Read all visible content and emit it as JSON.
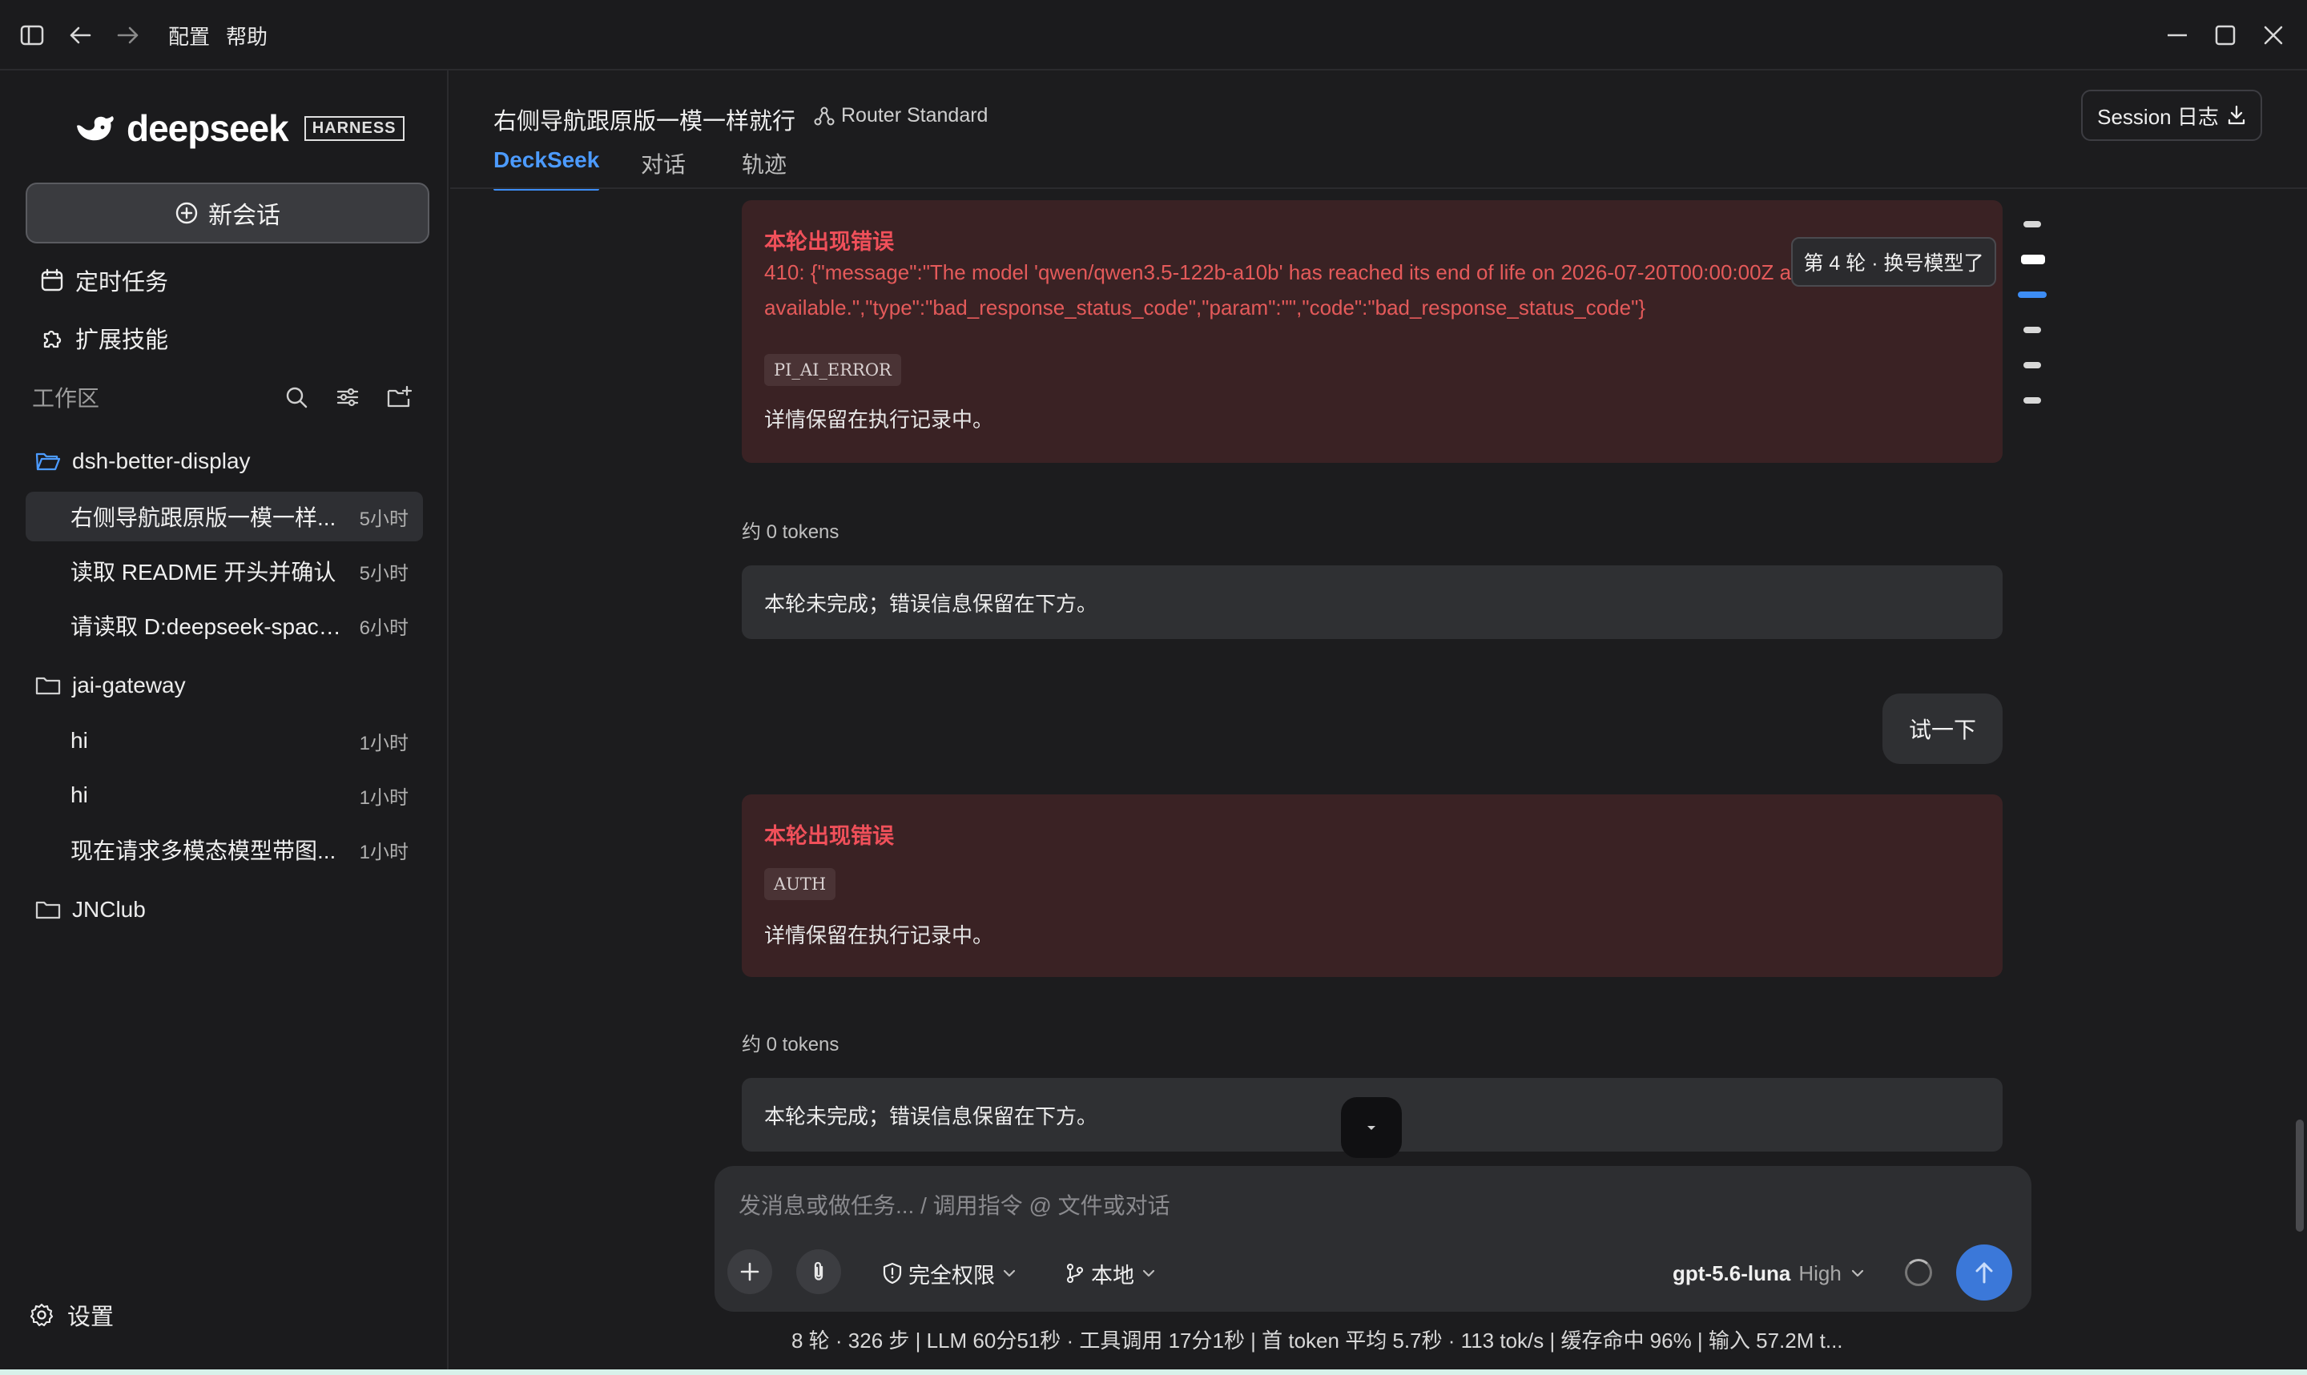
{
  "titlebar": {
    "menus": [
      "配置",
      "帮助"
    ]
  },
  "sidebar": {
    "logo_text": "deepseek",
    "logo_badge": "HARNESS",
    "new_chat_label": "新会话",
    "links": [
      {
        "label": "定时任务",
        "icon": "calendar-icon"
      },
      {
        "label": "扩展技能",
        "icon": "puzzle-icon"
      }
    ],
    "workspace_label": "工作区",
    "folders": [
      {
        "name": "dsh-better-display",
        "sessions": [
          {
            "title": "右侧导航跟原版一模一样...",
            "time": "5小时"
          },
          {
            "title": "读取 README 开头并确认",
            "time": "5小时"
          },
          {
            "title": "请读取 D:deepseek-space...",
            "time": "6小时"
          }
        ]
      },
      {
        "name": "jai-gateway",
        "sessions": [
          {
            "title": "hi",
            "time": "1小时"
          },
          {
            "title": "hi",
            "time": "1小时"
          },
          {
            "title": "现在请求多模态模型带图...",
            "time": "1小时"
          }
        ]
      },
      {
        "name": "JNClub",
        "sessions": []
      }
    ],
    "settings_label": "设置"
  },
  "header": {
    "title": "右侧导航跟原版一模一样就行",
    "router": "Router Standard",
    "session_log": "Session 日志",
    "tabs": [
      "DeckSeek",
      "对话",
      "轨迹"
    ]
  },
  "messages": {
    "error1": {
      "title": "本轮出现错误",
      "message": "410: {\"message\":\"The model 'qwen/qwen3.5-122b-a10b' has reached its end of life on 2026-07-20T00:00:00Z and is no longer available.\",\"type\":\"bad_response_status_code\",\"param\":\"\",\"code\":\"bad_response_status_code\"}",
      "code": "PI_AI_ERROR",
      "note": "详情保留在执行记录中。"
    },
    "tokens1": "约 0 tokens",
    "info1": "本轮未完成；错误信息保留在下方。",
    "user_message": "试一下",
    "error2": {
      "title": "本轮出现错误",
      "code": "AUTH",
      "note": "详情保留在执行记录中。"
    },
    "tokens2": "约 0 tokens",
    "info2": "本轮未完成；错误信息保留在下方。"
  },
  "round_nav": {
    "tooltip": "第 4 轮 · 换号模型了",
    "marker_count": 6,
    "hover_index": 1,
    "active_index": 2
  },
  "composer": {
    "placeholder": "发消息或做任务... / 调用指令 @ 文件或对话",
    "value": "",
    "permission": "完全权限",
    "location": "本地",
    "model": "gpt-5.6-luna",
    "level": "High"
  },
  "status_line": "8 轮 · 326 步  |  LLM 60分51秒 · 工具调用 17分1秒  |  首 token 平均 5.7秒 · 113 tok/s  |  缓存命中 96%  |  输入 57.2M t...",
  "colors": {
    "accent": "#3d8df5",
    "error": "#f0505a",
    "error_bg": "#3a2224"
  }
}
